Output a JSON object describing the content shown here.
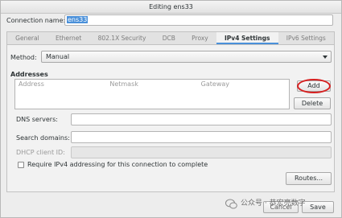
{
  "window": {
    "title": "Editing ens33"
  },
  "connection": {
    "label": "Connection name:",
    "value": "ens33"
  },
  "tabs": [
    {
      "label": "General",
      "active": false
    },
    {
      "label": "Ethernet",
      "active": false
    },
    {
      "label": "802.1X Security",
      "active": false
    },
    {
      "label": "DCB",
      "active": false
    },
    {
      "label": "Proxy",
      "active": false
    },
    {
      "label": "IPv4 Settings",
      "active": true
    },
    {
      "label": "IPv6 Settings",
      "active": false
    }
  ],
  "method": {
    "label": "Method:",
    "value": "Manual"
  },
  "addresses": {
    "heading": "Addresses",
    "columns": [
      "Address",
      "Netmask",
      "Gateway"
    ],
    "add_label": "Add",
    "delete_label": "Delete"
  },
  "fields": {
    "dns_label": "DNS servers:",
    "dns_value": "",
    "search_label": "Search domains:",
    "search_value": "",
    "dhcp_label": "DHCP client ID:",
    "dhcp_value": ""
  },
  "require_checkbox": {
    "label": "Require IPv4 addressing for this connection to complete",
    "checked": false
  },
  "routes_label": "Routes...",
  "footer": {
    "cancel_label": "Cancel",
    "save_label": "Save"
  },
  "watermark": {
    "text": "公众号 · 恭宏亮数字"
  },
  "colors": {
    "accent": "#4a90d9",
    "highlight_ring": "#d62020"
  }
}
